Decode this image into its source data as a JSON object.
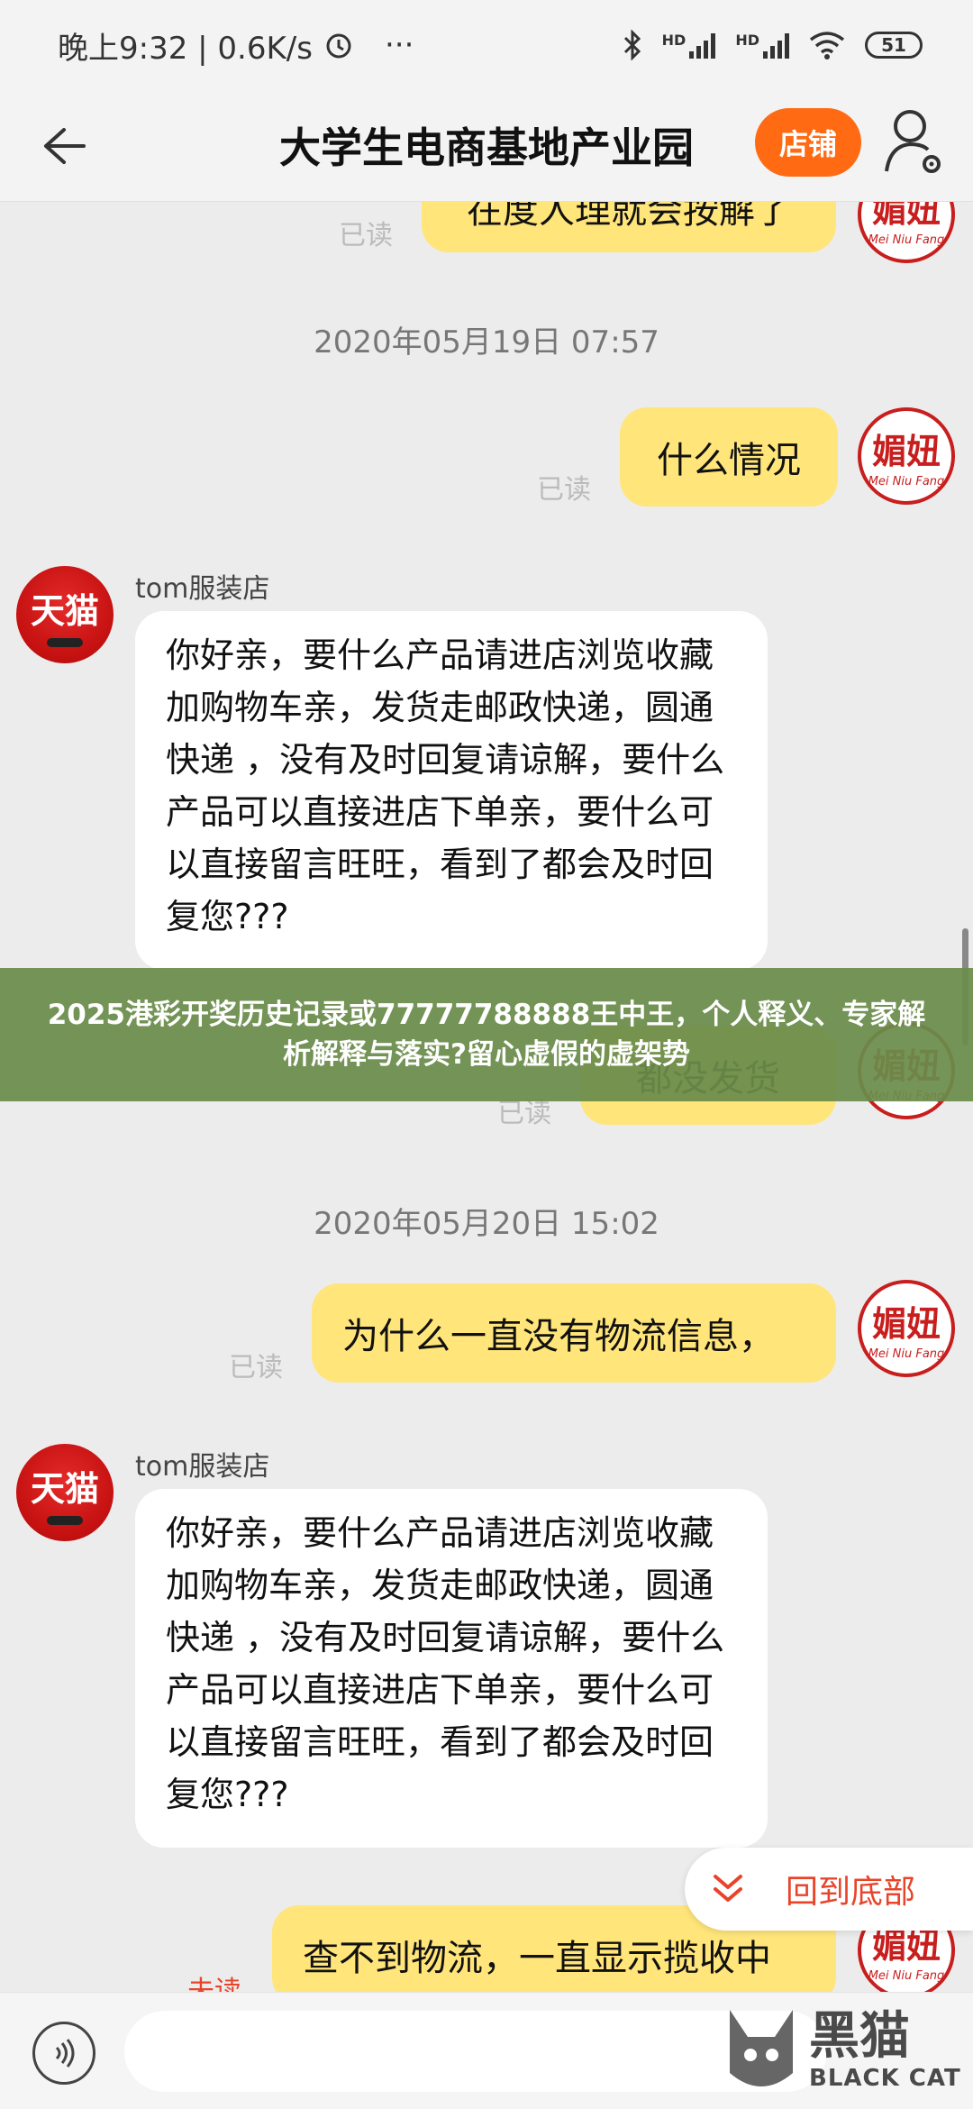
{
  "status_bar": {
    "time": "晚上9:32 | 0.6K/s",
    "more": "···",
    "net1": "HD",
    "net2": "HD",
    "battery": "51"
  },
  "header": {
    "title": "大学生电商基地产业园",
    "shop_button": "店铺"
  },
  "messages": {
    "top_partial": "在度人理就会按解了",
    "top_read": "已读",
    "ts1": "2020年05月19日 07:57",
    "m1_text": "什么情况",
    "m1_read": "已读",
    "shop_name": "tom服装店",
    "shop_reply": "你好亲，要什么产品请进店浏览收藏加购物车亲，发货走邮政快递，圆通快递 ，没有及时回复请谅解，要什么产品可以直接进店下单亲，要什么可以直接留言旺旺，看到了都会及时回复您???",
    "m2_text": "都没发货",
    "m2_read": "已读",
    "ts2": "2020年05月20日 15:02",
    "m3_text": "为什么一直没有物流信息，",
    "m3_read": "已读",
    "shop_name2": "tom服装店",
    "shop_reply2": "你好亲，要什么产品请进店浏览收藏加购物车亲，发货走邮政快递，圆通快递 ，没有及时回复请谅解，要什么产品可以直接进店下单亲，要什么可以直接留言旺旺，看到了都会及时回复您???",
    "m4_text": "查不到物流，一直显示揽收中",
    "m4_read": "未读"
  },
  "avatars": {
    "shop_label": "天猫",
    "user_label": "媚妞",
    "user_sub": "Mei Niu Fang"
  },
  "banner": "2025港彩开奖历史记录或77777788888王中王，个人释义、专家解析解释与落实?留心虚假的虚架势",
  "to_bottom": "回到底部",
  "input": {
    "placeholder": ""
  },
  "watermark": {
    "cn": "黑猫",
    "en": "BLACK CAT"
  },
  "colors": {
    "accent": "#ff6a12",
    "bubble_self": "#ffe57a",
    "banner": "#6a8c4a",
    "to_bottom": "#e8442a"
  }
}
